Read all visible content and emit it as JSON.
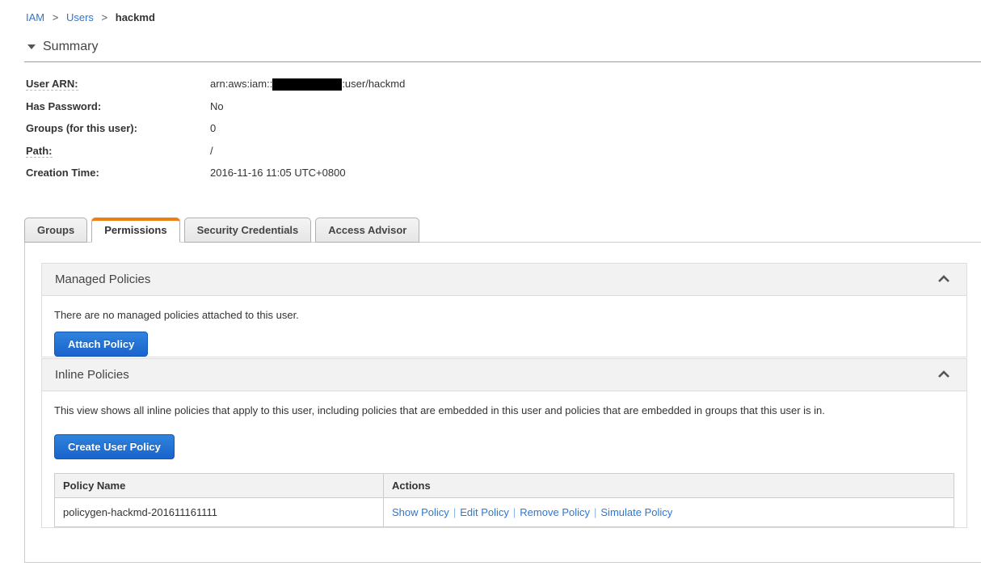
{
  "breadcrumb": {
    "separator": ">",
    "items": [
      {
        "label": "IAM"
      },
      {
        "label": "Users"
      },
      {
        "label": "hackmd"
      }
    ]
  },
  "summary": {
    "title": "Summary",
    "fields": {
      "user_arn": {
        "label": "User ARN:",
        "value_prefix": "arn:aws:iam::",
        "value_suffix": ":user/hackmd"
      },
      "has_password": {
        "label": "Has Password:",
        "value": "No"
      },
      "groups": {
        "label": "Groups (for this user):",
        "value": "0"
      },
      "path": {
        "label": "Path:",
        "value": "/"
      },
      "creation_time": {
        "label": "Creation Time:",
        "value": "2016-11-16 11:05 UTC+0800"
      }
    }
  },
  "tabs": [
    {
      "label": "Groups",
      "active": false
    },
    {
      "label": "Permissions",
      "active": true
    },
    {
      "label": "Security Credentials",
      "active": false
    },
    {
      "label": "Access Advisor",
      "active": false
    }
  ],
  "managed_policies": {
    "title": "Managed Policies",
    "empty_message": "There are no managed policies attached to this user.",
    "attach_button": "Attach Policy"
  },
  "inline_policies": {
    "title": "Inline Policies",
    "description": "This view shows all inline policies that apply to this user, including policies that are embedded in this user and policies that are embedded in groups that this user is in.",
    "create_button": "Create User Policy",
    "table": {
      "headers": [
        "Policy Name",
        "Actions"
      ],
      "actions_separator": "|",
      "rows": [
        {
          "policy_name": "policygen-hackmd-201611161111",
          "actions": [
            "Show Policy",
            "Edit Policy",
            "Remove Policy",
            "Simulate Policy"
          ]
        }
      ]
    }
  },
  "colors": {
    "link_blue": "#2e77d0",
    "accent_orange": "#ee7f0e",
    "button_blue": "#1a63cd"
  }
}
